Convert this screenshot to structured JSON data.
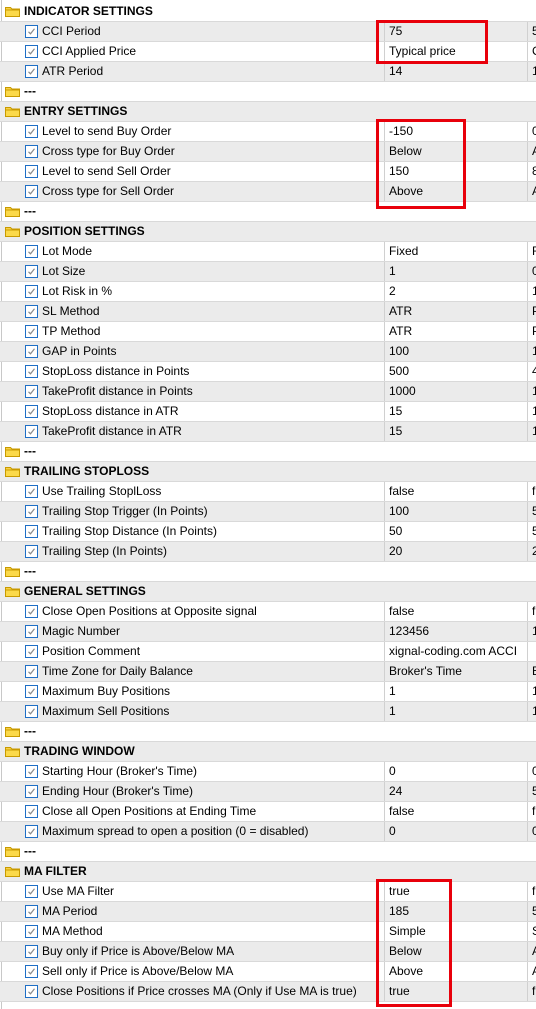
{
  "colors": {
    "highlight_box": "#e8000b",
    "checkbox_border": "#1f6fc6",
    "folder": "#f5c400",
    "row_alt": "#ebebeb"
  },
  "icons": {
    "group": "folder-icon",
    "param": "checkbox-checked-icon"
  },
  "groups": [
    {
      "title": "INDICATOR SETTINGS",
      "params": [
        {
          "name": "CCI Period",
          "value": "75",
          "start": "5"
        },
        {
          "name": "CCI Applied Price",
          "value": "Typical price",
          "start": "C"
        },
        {
          "name": "ATR Period",
          "value": "14",
          "start": "1"
        }
      ]
    },
    {
      "title": "---",
      "params": []
    },
    {
      "title": "ENTRY SETTINGS",
      "params": [
        {
          "name": "Level to send Buy Order",
          "value": "-150",
          "start": "0"
        },
        {
          "name": "Cross type for Buy Order",
          "value": "Below",
          "start": "A"
        },
        {
          "name": "Level to send Sell Order",
          "value": "150",
          "start": "8"
        },
        {
          "name": "Cross type for Sell Order",
          "value": "Above",
          "start": "A"
        }
      ]
    },
    {
      "title": "---",
      "params": []
    },
    {
      "title": "POSITION SETTINGS",
      "params": [
        {
          "name": "Lot Mode",
          "value": "Fixed",
          "start": "F"
        },
        {
          "name": "Lot Size",
          "value": "1",
          "start": "0"
        },
        {
          "name": "Lot Risk in %",
          "value": "2",
          "start": "1"
        },
        {
          "name": "SL Method",
          "value": "ATR",
          "start": "P"
        },
        {
          "name": "TP Method",
          "value": "ATR",
          "start": "P"
        },
        {
          "name": "GAP in Points",
          "value": "100",
          "start": "1"
        },
        {
          "name": "StopLoss distance in Points",
          "value": "500",
          "start": "4"
        },
        {
          "name": "TakeProfit distance in Points",
          "value": "1000",
          "start": "1"
        },
        {
          "name": "StopLoss distance in ATR",
          "value": "15",
          "start": "1"
        },
        {
          "name": "TakeProfit distance in ATR",
          "value": "15",
          "start": "1"
        }
      ]
    },
    {
      "title": "---",
      "params": []
    },
    {
      "title": "TRAILING STOPLOSS",
      "params": [
        {
          "name": "Use Trailing StoplLoss",
          "value": "false",
          "start": "f"
        },
        {
          "name": "Trailing Stop Trigger (In Points)",
          "value": "100",
          "start": "5"
        },
        {
          "name": "Trailing Stop Distance (In Points)",
          "value": "50",
          "start": "5"
        },
        {
          "name": "Trailing Step (In Points)",
          "value": "20",
          "start": "2"
        }
      ]
    },
    {
      "title": "---",
      "params": []
    },
    {
      "title": "GENERAL SETTINGS",
      "params": [
        {
          "name": "Close Open Positions at Opposite signal",
          "value": "false",
          "start": "f"
        },
        {
          "name": "Magic Number",
          "value": "123456",
          "start": "1"
        },
        {
          "name": "Position Comment",
          "value": "xignal-coding.com ACCI",
          "start": ""
        },
        {
          "name": "Time Zone for Daily Balance",
          "value": "Broker's Time",
          "start": "B"
        },
        {
          "name": "Maximum Buy Positions",
          "value": "1",
          "start": "1"
        },
        {
          "name": "Maximum Sell Positions",
          "value": "1",
          "start": "1"
        }
      ]
    },
    {
      "title": "---",
      "params": []
    },
    {
      "title": "TRADING WINDOW",
      "params": [
        {
          "name": "Starting Hour (Broker's Time)",
          "value": "0",
          "start": "0"
        },
        {
          "name": "Ending Hour (Broker's Time)",
          "value": "24",
          "start": "5"
        },
        {
          "name": "Close all Open Positions at Ending Time",
          "value": "false",
          "start": "f"
        },
        {
          "name": "Maximum spread to open a position (0 = disabled)",
          "value": "0",
          "start": "0"
        }
      ]
    },
    {
      "title": "---",
      "params": []
    },
    {
      "title": "MA FILTER",
      "params": [
        {
          "name": "Use MA Filter",
          "value": "true",
          "start": "f"
        },
        {
          "name": "MA Period",
          "value": "185",
          "start": "5"
        },
        {
          "name": "MA Method",
          "value": "Simple",
          "start": "S"
        },
        {
          "name": "Buy only if Price is Above/Below MA",
          "value": "Below",
          "start": "A"
        },
        {
          "name": "Sell only if Price is Above/Below MA",
          "value": "Above",
          "start": "A"
        },
        {
          "name": "Close Positions if Price crosses MA (Only if Use MA is true)",
          "value": "true",
          "start": "f"
        }
      ]
    }
  ]
}
